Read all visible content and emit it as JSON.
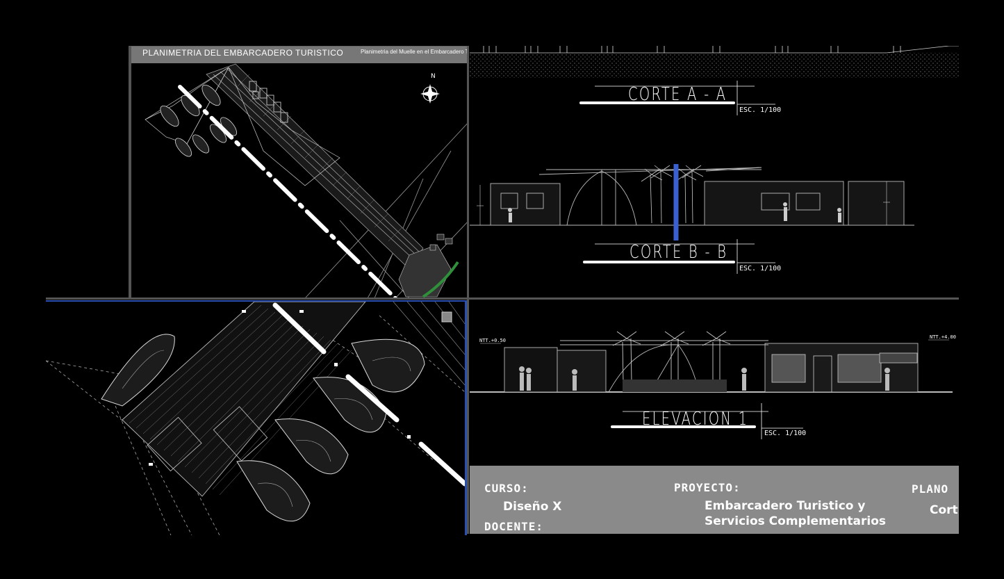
{
  "plan": {
    "title": "PLANIMETRIA DEL EMBARCADERO TURISTICO",
    "subtitle": "Planimetria del Muelle en el Embarcadero T",
    "north_label": "N"
  },
  "sections": {
    "section_a": {
      "title": "CORTE A - A",
      "scale": "ESC. 1/100"
    },
    "section_b": {
      "title": "CORTE B - B",
      "scale": "ESC. 1/100"
    }
  },
  "elevation": {
    "title": "ELEVACION 1",
    "scale": "ESC. 1/100",
    "level_left": "NTT.+0.50",
    "level_right": "NTT.+4.00"
  },
  "title_block": {
    "curso_label": "CURSO:",
    "curso_value": "Diseño X",
    "docente_label": "DOCENTE:",
    "proyecto_label": "PROYECTO:",
    "proyecto_line1": "Embarcadero Turistico y",
    "proyecto_line2": "Servicios Complementarios",
    "plano_label": "PLANO",
    "plano_value": "Cort"
  },
  "colors": {
    "background": "#000000",
    "linework": "#bbbbbb",
    "viewport_border": "#2a4fb3",
    "title_block": "#8a8a8a",
    "section_marker": "#3a5fcf"
  }
}
